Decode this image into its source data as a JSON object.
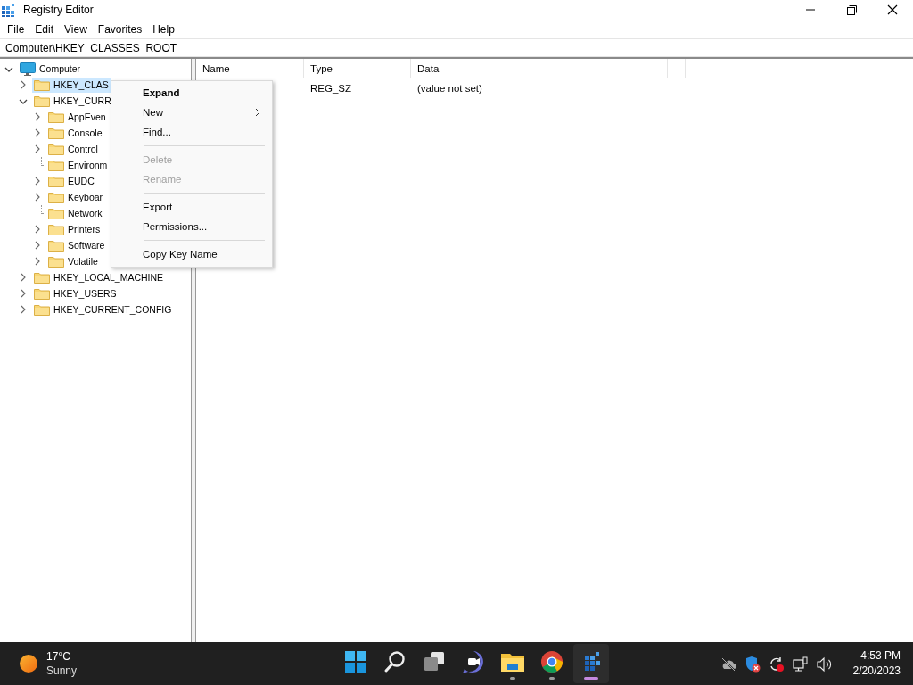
{
  "window": {
    "title": "Registry Editor"
  },
  "menu_bar": [
    "File",
    "Edit",
    "View",
    "Favorites",
    "Help"
  ],
  "address": "Computer\\HKEY_CLASSES_ROOT",
  "tree": [
    {
      "label": "Computer",
      "kind": "computer",
      "expanded": true,
      "selected": false,
      "children": [
        {
          "label": "HKEY_CLAS",
          "kind": "branch",
          "expanded": false,
          "selected": true
        },
        {
          "label": "HKEY_CURR",
          "kind": "branch",
          "expanded": true,
          "selected": false,
          "children": [
            {
              "label": "AppEven",
              "kind": "branch",
              "expanded": false,
              "selected": false
            },
            {
              "label": "Console",
              "kind": "branch",
              "expanded": false,
              "selected": false
            },
            {
              "label": "Control",
              "kind": "branch",
              "expanded": false,
              "selected": false
            },
            {
              "label": "Environm",
              "kind": "leaf",
              "selected": false
            },
            {
              "label": "EUDC",
              "kind": "branch",
              "expanded": false,
              "selected": false
            },
            {
              "label": "Keyboar",
              "kind": "branch",
              "expanded": false,
              "selected": false
            },
            {
              "label": "Network",
              "kind": "leaf",
              "selected": false
            },
            {
              "label": "Printers",
              "kind": "branch",
              "expanded": false,
              "selected": false
            },
            {
              "label": "Software",
              "kind": "branch",
              "expanded": false,
              "selected": false
            },
            {
              "label": "Volatile",
              "kind": "branch",
              "expanded": false,
              "selected": false
            }
          ]
        },
        {
          "label": "HKEY_LOCAL_MACHINE",
          "kind": "branch",
          "expanded": false,
          "selected": false
        },
        {
          "label": "HKEY_USERS",
          "kind": "branch",
          "expanded": false,
          "selected": false
        },
        {
          "label": "HKEY_CURRENT_CONFIG",
          "kind": "branch",
          "expanded": false,
          "selected": false
        }
      ]
    }
  ],
  "table": {
    "columns": [
      "Name",
      "Type",
      "Data"
    ],
    "rows": [
      {
        "type": "REG_SZ",
        "data": "(value not set)"
      }
    ]
  },
  "context_menu": [
    {
      "kind": "item",
      "label": "Expand",
      "default": true,
      "disabled": false,
      "submenu": false
    },
    {
      "kind": "item",
      "label": "New",
      "default": false,
      "disabled": false,
      "submenu": true
    },
    {
      "kind": "item",
      "label": "Find...",
      "default": false,
      "disabled": false,
      "submenu": false
    },
    {
      "kind": "separator"
    },
    {
      "kind": "item",
      "label": "Delete",
      "default": false,
      "disabled": true,
      "submenu": false
    },
    {
      "kind": "item",
      "label": "Rename",
      "default": false,
      "disabled": true,
      "submenu": false
    },
    {
      "kind": "separator"
    },
    {
      "kind": "item",
      "label": "Export",
      "default": false,
      "disabled": false,
      "submenu": false
    },
    {
      "kind": "item",
      "label": "Permissions...",
      "default": false,
      "disabled": false,
      "submenu": false
    },
    {
      "kind": "separator"
    },
    {
      "kind": "item",
      "label": "Copy Key Name",
      "default": false,
      "disabled": false,
      "submenu": false
    }
  ],
  "taskbar": {
    "weather": {
      "temperature": "17°C",
      "condition": "Sunny"
    },
    "apps": [
      {
        "kind": "start",
        "running": false,
        "active": false
      },
      {
        "kind": "search",
        "running": false,
        "active": false
      },
      {
        "kind": "task-view",
        "running": false,
        "active": false
      },
      {
        "kind": "chat",
        "running": false,
        "active": false
      },
      {
        "kind": "explorer",
        "running": true,
        "active": false
      },
      {
        "kind": "browser",
        "running": true,
        "active": false
      },
      {
        "kind": "regedit",
        "running": true,
        "active": true
      }
    ],
    "tray": [
      {
        "kind": "cloud-off"
      },
      {
        "kind": "security"
      },
      {
        "kind": "sync"
      },
      {
        "kind": "network"
      },
      {
        "kind": "volume"
      }
    ],
    "time": "4:53 PM",
    "date": "2/20/2023"
  }
}
